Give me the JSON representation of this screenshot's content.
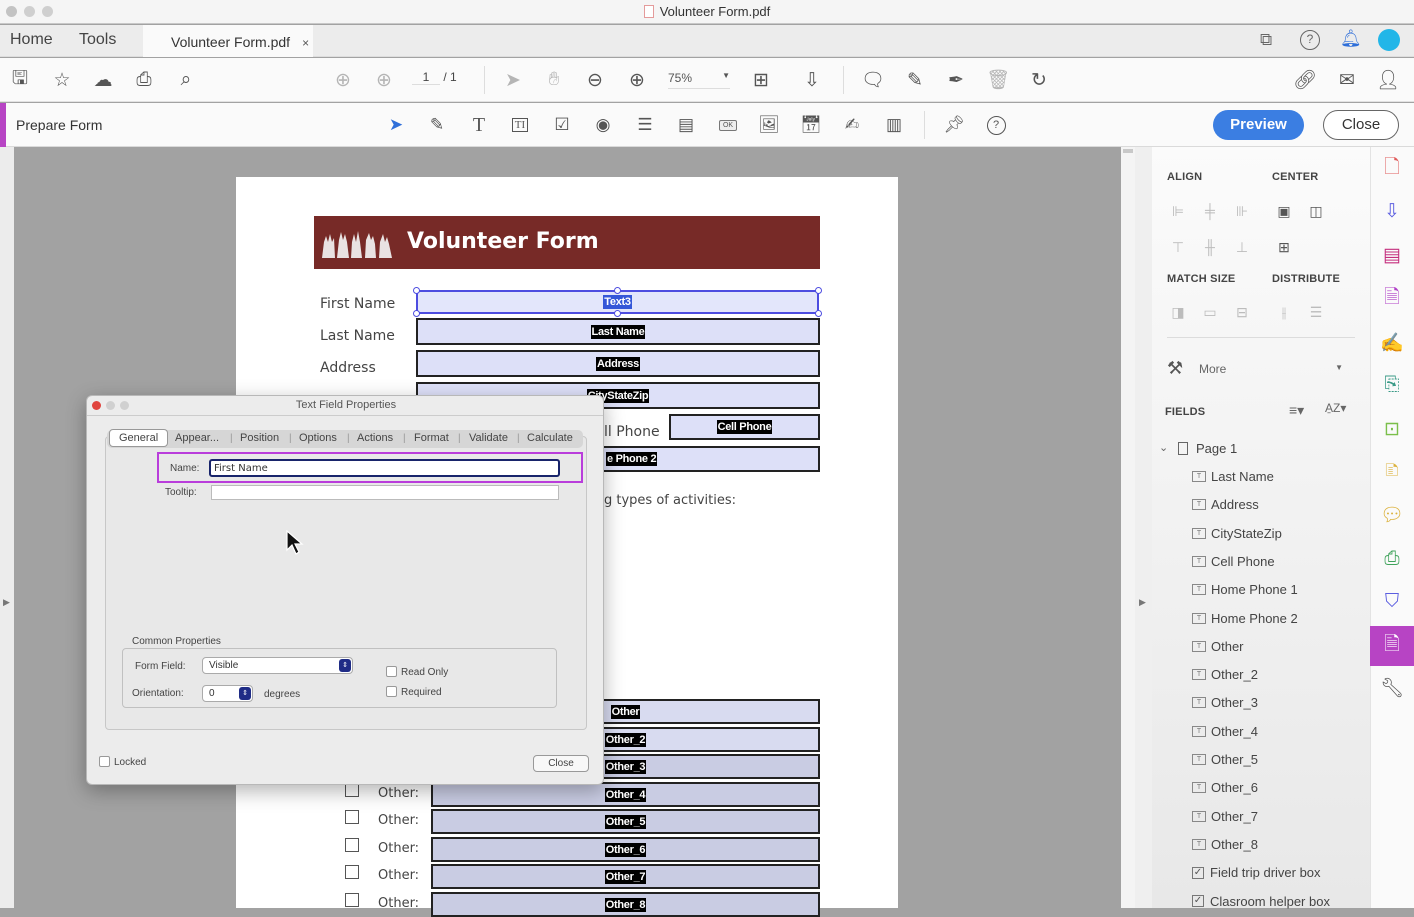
{
  "window": {
    "title": "Volunteer Form.pdf"
  },
  "nav": {
    "home": "Home",
    "tools": "Tools",
    "doc_tab": "Volunteer Form.pdf",
    "doc_tab_close": "×"
  },
  "toolbar": {
    "page_current": "1",
    "page_total": "/ 1",
    "zoom": "75%",
    "icons": [
      "save-icon",
      "bookmark-star-icon",
      "upload-cloud-icon",
      "print-icon",
      "search-icon",
      "prev-page-icon",
      "next-page-icon",
      "select-arrow-icon",
      "hand-icon",
      "zoom-out-icon",
      "zoom-in-icon",
      "fit-page-icon",
      "scroll-mode-icon",
      "comment-icon",
      "highlight-pen-icon",
      "sign-icon",
      "delete-icon",
      "rotate-icon",
      "share-link-icon",
      "email-icon",
      "add-user-icon"
    ]
  },
  "header_icons": [
    "share-feedback-icon",
    "help-icon",
    "notifications-bell-icon",
    "account-avatar"
  ],
  "formbar": {
    "title": "Prepare Form",
    "preview": "Preview",
    "close": "Close",
    "tools": [
      "select-tool",
      "edit-form-tool",
      "text-tool",
      "text-field-tool",
      "checkbox-tool",
      "radio-button-tool",
      "list-box-tool",
      "dropdown-tool",
      "button-tool",
      "image-tool",
      "date-field-tool",
      "signature-tool",
      "barcode-tool",
      "pin-tool",
      "help-tool"
    ]
  },
  "document": {
    "title": "Volunteer Form",
    "labels": {
      "first_name": "First Name",
      "last_name": "Last Name",
      "address": "Address",
      "cell_phone": "ll Phone",
      "activities": "g types of activities:",
      "other": "Other:"
    },
    "fields": {
      "first": "Text3",
      "last": "Last Name",
      "address": "Address",
      "city": "CityStateZip",
      "cell": "Cell Phone",
      "home2": "e Phone 2"
    },
    "other_fields": [
      "Other",
      "Other_2",
      "Other_3",
      "Other_4",
      "Other_5",
      "Other_6",
      "Other_7",
      "Other_8"
    ],
    "brand_color": "#772a27"
  },
  "dialog": {
    "title": "Text Field Properties",
    "tabs": [
      "General",
      "Appear...",
      "Position",
      "Options",
      "Actions",
      "Format",
      "Validate",
      "Calculate"
    ],
    "active_tab": "General",
    "name_label": "Name:",
    "name_value": "First Name",
    "tooltip_label": "Tooltip:",
    "tooltip_value": "",
    "common_title": "Common Properties",
    "form_field_label": "Form Field:",
    "form_field_value": "Visible",
    "orientation_label": "Orientation:",
    "orientation_value": "0",
    "degrees": "degrees",
    "read_only": "Read Only",
    "read_only_checked": false,
    "required": "Required",
    "required_checked": false,
    "locked": "Locked",
    "locked_checked": false,
    "close": "Close"
  },
  "sidebar": {
    "align": "ALIGN",
    "center": "CENTER",
    "match_size": "MATCH SIZE",
    "distribute": "DISTRIBUTE",
    "more": "More",
    "fields": "FIELDS",
    "page": "Page 1",
    "field_items": [
      {
        "label": "Last Name",
        "type": "text"
      },
      {
        "label": "Address",
        "type": "text"
      },
      {
        "label": "CityStateZip",
        "type": "text"
      },
      {
        "label": "Cell Phone",
        "type": "text"
      },
      {
        "label": "Home Phone 1",
        "type": "text"
      },
      {
        "label": "Home Phone 2",
        "type": "text"
      },
      {
        "label": "Other",
        "type": "text"
      },
      {
        "label": "Other_2",
        "type": "text"
      },
      {
        "label": "Other_3",
        "type": "text"
      },
      {
        "label": "Other_4",
        "type": "text"
      },
      {
        "label": "Other_5",
        "type": "text"
      },
      {
        "label": "Other_6",
        "type": "text"
      },
      {
        "label": "Other_7",
        "type": "text"
      },
      {
        "label": "Other_8",
        "type": "text"
      },
      {
        "label": "Field trip driver box",
        "type": "checkbox"
      },
      {
        "label": "Clasroom helper box",
        "type": "checkbox"
      }
    ]
  },
  "rail": [
    "create-pdf-icon",
    "export-pdf-icon",
    "organize-pages-icon",
    "edit-pdf-icon",
    "fill-sign-icon",
    "send-for-signature-icon",
    "compress-icon",
    "request-signatures-icon",
    "comment-icon",
    "print-production-icon",
    "protect-icon",
    "prepare-form-icon",
    "more-tools-icon"
  ],
  "colors": {
    "accent": "#b744c4",
    "preview": "#3b7ee2"
  }
}
